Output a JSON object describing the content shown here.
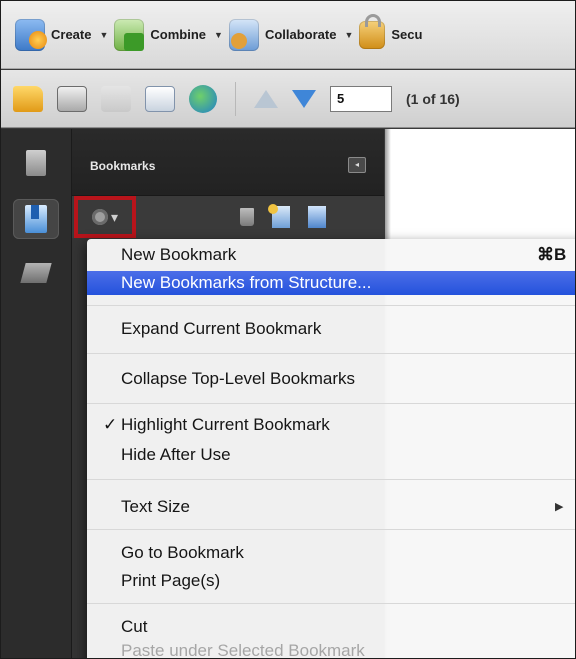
{
  "toolbar1": {
    "buttons": [
      {
        "label": "Create",
        "icon": "create-pdf-icon"
      },
      {
        "label": "Combine",
        "icon": "combine-files-icon"
      },
      {
        "label": "Collaborate",
        "icon": "collaborate-icon"
      },
      {
        "label": "Secu",
        "icon": "lock-icon"
      }
    ]
  },
  "toolbar2": {
    "page_number": "5",
    "page_of": "(1 of 16)"
  },
  "panel": {
    "title": "Bookmarks",
    "options_caret": "▾"
  },
  "menu": {
    "items": [
      {
        "label": "New Bookmark",
        "shortcut": "⌘B"
      },
      {
        "label": "New Bookmarks from Structure..."
      },
      {
        "label": "Expand Current Bookmark"
      },
      {
        "label": "Collapse Top-Level Bookmarks"
      },
      {
        "label": "Highlight Current Bookmark",
        "check": "✓"
      },
      {
        "label": "Hide After Use"
      },
      {
        "label": "Text Size",
        "submenu_arrow": "▶"
      },
      {
        "label": "Go to Bookmark"
      },
      {
        "label": "Print Page(s)"
      },
      {
        "label": "Cut"
      },
      {
        "label": "Paste under Selected Bookmark"
      }
    ],
    "selected_index": 1
  },
  "colors": {
    "highlight": "#2a56de",
    "callout_border": "#b8141b",
    "panel_bg": "#343434"
  }
}
